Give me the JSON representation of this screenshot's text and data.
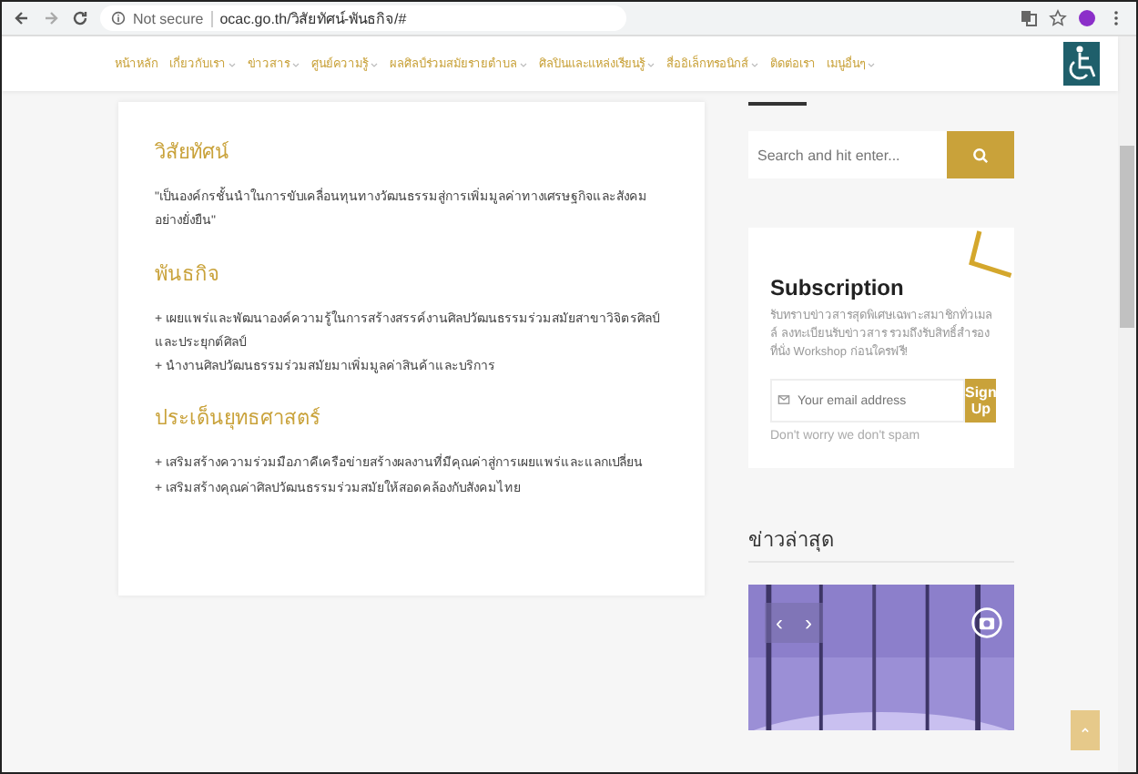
{
  "browser": {
    "security": "Not secure",
    "url": "ocac.go.th/วิสัยทัศน์-พันธกิจ/#"
  },
  "nav": [
    {
      "label": "หน้าหลัก",
      "dropdown": false
    },
    {
      "label": "เกี่ยวกับเรา",
      "dropdown": true
    },
    {
      "label": "ข่าวสาร",
      "dropdown": true
    },
    {
      "label": "ศูนย์ความรู้",
      "dropdown": true
    },
    {
      "label": "ผลศิลป์ร่วมสมัยรายตำบล",
      "dropdown": true
    },
    {
      "label": "ศิลปินและแหล่งเรียนรู้",
      "dropdown": true
    },
    {
      "label": "สื่ออิเล็กทรอนิกส์",
      "dropdown": true
    },
    {
      "label": "ติดต่อเรา",
      "dropdown": false
    },
    {
      "label": "เมนูอื่นๆ",
      "dropdown": true
    }
  ],
  "sections": [
    {
      "heading": "วิสัยทัศน์",
      "lines": [
        "\"เป็นองค์กรชั้นนำในการขับเคลื่อนทุนทางวัฒนธรรมสู่การเพิ่มมูลค่าทางเศรษฐกิจและสังคมอย่างยั่งยืน\""
      ]
    },
    {
      "heading": "พันธกิจ",
      "lines": [
        "+ เผยแพร่และพัฒนาองค์ความรู้ในการสร้างสรรค์งานศิลปวัฒนธรรมร่วมสมัยสาขาวิจิตรศิลป์และประยุกต์ศิลป์",
        "+ นำงานศิลปวัฒนธรรมร่วมสมัยมาเพิ่มมูลค่าสินค้าและบริการ"
      ]
    },
    {
      "heading": "ประเด็นยุทธศาสตร์",
      "lines": [
        "+ เสริมสร้างความร่วมมือภาคีเครือข่ายสร้างผลงานที่มีคุณค่าสู่การเผยแพร่และแลกเปลี่ยน",
        "+ เสริมสร้างคุณค่าศิลปวัฒนธรรมร่วมสมัยให้สอดคล้องกับสังคมไทย"
      ]
    }
  ],
  "sidebar": {
    "search": {
      "placeholder": "Search and hit enter..."
    },
    "subscription": {
      "title": "Subscription",
      "text": "รับทราบข่าวสารสุดพิเศษเฉพาะสมาชิกทั่วเมลล์ ลงทะเบียนรับข่าวสาร รวมถึงรับสิทธิ์สำรองที่นั่ง Workshop ก่อนใครฟรี!",
      "placeholder": "Your email address",
      "button": "Sign Up",
      "note": "Don't worry we don't spam"
    },
    "news": {
      "heading": "ข่าวล่าสุด",
      "prev": "‹",
      "next": "›"
    }
  }
}
